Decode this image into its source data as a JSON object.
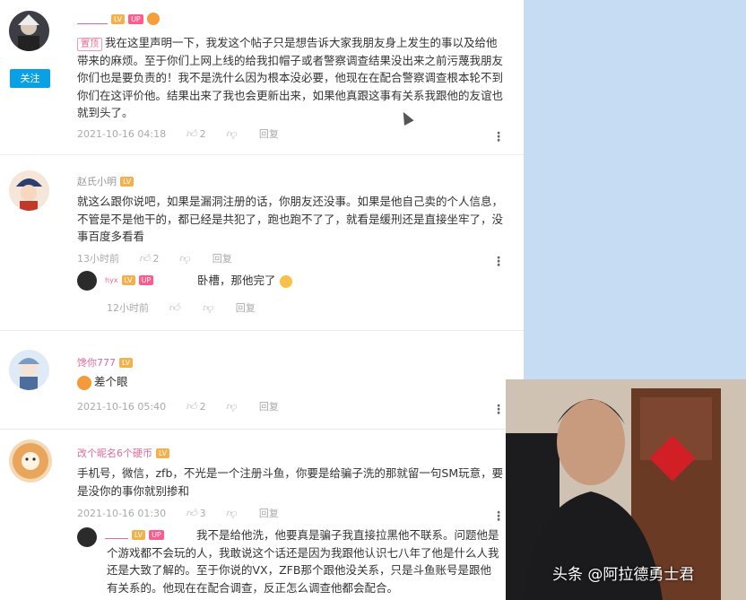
{
  "comments": [
    {
      "name": "",
      "badges": [
        "LV",
        "UP"
      ],
      "follow_label": "关注",
      "tag": "置顶",
      "text": "我在这里声明一下，我发这个帖子只是想告诉大家我朋友身上发生的事以及给他带来的麻烦。至于你们上网上线的给我扣帽子或者警察调查结果没出来之前污蔑我朋友你们也是要负责的！我不是洗什么因为根本没必要，他现在在配合警察调查根本轮不到你们在这评价他。结果出来了我也会更新出来，如果他真跟这事有关系我跟他的友谊也就到头了。",
      "time": "2021-10-16 04:18",
      "likes": "2",
      "reply": "回复"
    },
    {
      "name": "赵氏小明",
      "badges": [
        "LV"
      ],
      "text": "就这么跟你说吧，如果是漏洞注册的话，你朋友还没事。如果是他自己卖的个人信息，不管是不是他干的，都已经是共犯了，跑也跑不了了，就看是缓刑还是直接坐牢了，没事百度多看看",
      "time": "13小时前",
      "likes": "2",
      "reply": "回复",
      "sub_reply": {
        "name": "hyx",
        "badges": [
          "LV",
          "UP"
        ],
        "text": "卧槽，那他完了",
        "time": "12小时前",
        "reply": "回复"
      }
    },
    {
      "name": "馋你777",
      "badges": [
        "LV"
      ],
      "text": "差个眼",
      "time": "2021-10-16 05:40",
      "likes": "2",
      "reply": "回复"
    },
    {
      "name": "改个昵名6个硬币",
      "badges": [
        "LV"
      ],
      "text": "手机号，微信，zfb，不光是一个注册斗鱼，你要是给骗子洗的那就留一句SM玩意，要是没你的事你就别掺和",
      "time": "2021-10-16 01:30",
      "likes": "3",
      "reply": "回复",
      "sub_reply": {
        "name": "",
        "badges": [
          "LV",
          "UP"
        ],
        "text": "我不是给他洗，他要真是骗子我直接拉黑他不联系。问题他是个游戏都不会玩的人，我敢说这个话还是因为我跟他认识七八年了他是什么人我还是大致了解的。至于你说的VX，ZFB那个跟他没关系，只是斗鱼账号是跟他有关系的。他现在在配合调查，反正怎么调查他都会配合。"
      }
    }
  ],
  "watermark": "头条 @阿拉德勇士君",
  "colors": {
    "accent": "#0aa0e6",
    "side_panel": "#c5dcf2",
    "name_pink": "#e26a9a"
  },
  "icons": {
    "like": "thumbs-up-icon",
    "dislike": "thumbs-down-icon",
    "more": "more-vertical-icon"
  }
}
